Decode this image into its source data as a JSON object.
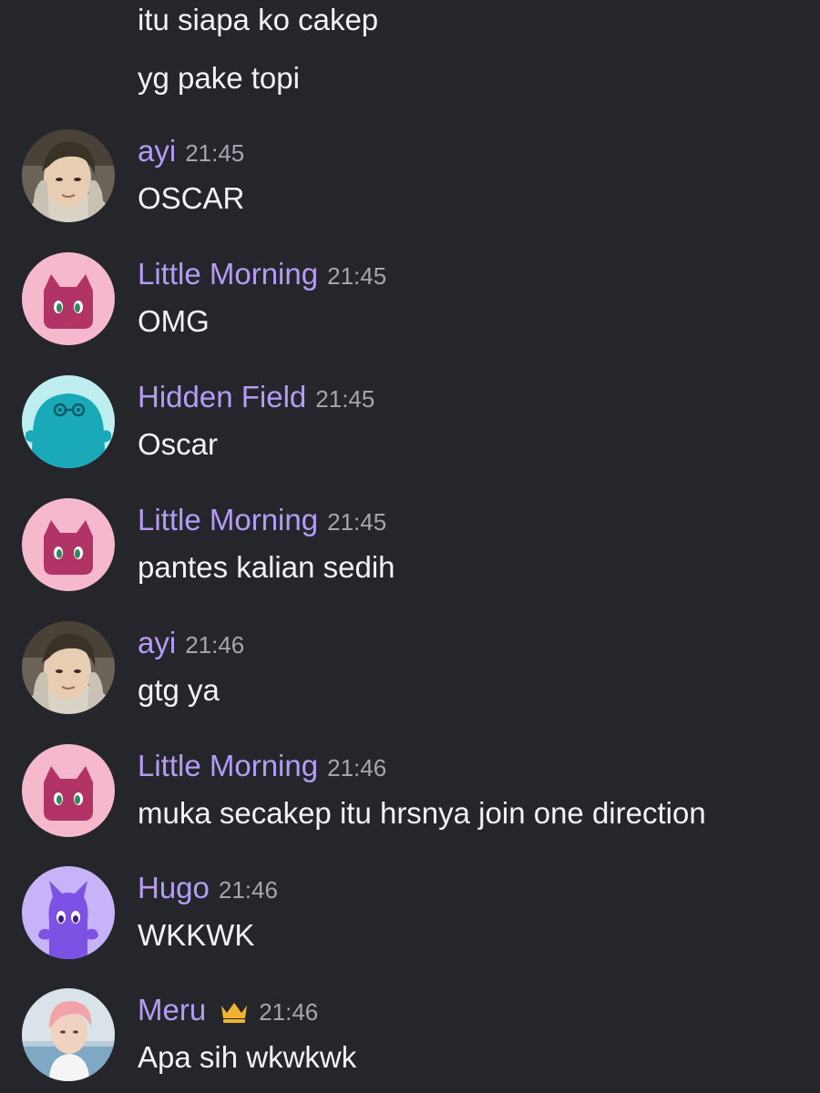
{
  "colors": {
    "background": "#25262c",
    "username": "#b49cf4",
    "timestamp": "#a3a6ad",
    "text": "#f2f3f5",
    "crown": "#f0b232"
  },
  "continuation_messages": [
    {
      "content": "itu siapa ko cakep"
    },
    {
      "content": "yg pake topi"
    }
  ],
  "messages": [
    {
      "username": "ayi",
      "timestamp": "21:45",
      "content": "OSCAR",
      "avatar": "photo-avatar"
    },
    {
      "username": "Little Morning",
      "timestamp": "21:45",
      "content": "OMG",
      "avatar": "pink-cat-avatar"
    },
    {
      "username": "Hidden Field",
      "timestamp": "21:45",
      "content": "Oscar",
      "avatar": "teal-blob-avatar"
    },
    {
      "username": "Little Morning",
      "timestamp": "21:45",
      "content": "pantes kalian sedih",
      "avatar": "pink-cat-avatar"
    },
    {
      "username": "ayi",
      "timestamp": "21:46",
      "content": "gtg ya",
      "avatar": "photo-avatar"
    },
    {
      "username": "Little Morning",
      "timestamp": "21:46",
      "content": "muka secakep itu hrsnya join one direction",
      "avatar": "pink-cat-avatar"
    },
    {
      "username": "Hugo",
      "timestamp": "21:46",
      "content": "WKKWK",
      "avatar": "purple-creature-avatar"
    },
    {
      "username": "Meru",
      "timestamp": "21:46",
      "content": "Apa sih wkwkwk",
      "avatar": "photo-avatar-pink-hair",
      "badge": "crown-icon"
    }
  ]
}
